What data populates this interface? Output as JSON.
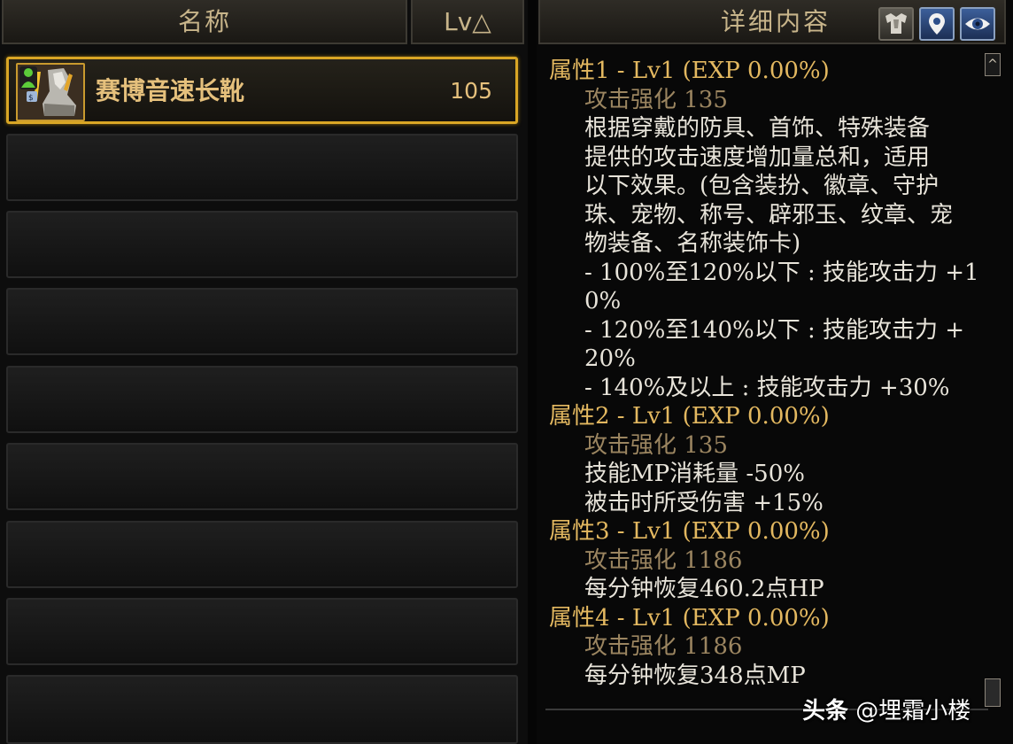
{
  "list": {
    "col_name": "名称",
    "col_lv": "Lv△",
    "items": [
      {
        "name": "赛博音速长靴",
        "level": "105",
        "icon": "boots-icon"
      }
    ]
  },
  "detail": {
    "title": "详细内容",
    "buttons": [
      {
        "icon": "armor-icon"
      },
      {
        "icon": "location-pin-icon"
      },
      {
        "icon": "eye-icon"
      }
    ],
    "scroll_up": "^",
    "lines": [
      {
        "text": "属性1 - Lv1 (EXP 0.00%)",
        "style": "gold"
      },
      {
        "text": "攻击强化 135",
        "style": "dim"
      },
      {
        "text": "根据穿戴的防具、首饰、特殊装备",
        "style": "white"
      },
      {
        "text": "提供的攻击速度增加量总和，适用",
        "style": "white"
      },
      {
        "text": "以下效果。(包含装扮、徽章、守护",
        "style": "white"
      },
      {
        "text": "珠、宠物、称号、辟邪玉、纹章、宠",
        "style": "white"
      },
      {
        "text": "物装备、名称装饰卡)",
        "style": "white"
      },
      {
        "text": "- 100%至120%以下 : 技能攻击力 +1",
        "style": "white"
      },
      {
        "text": "0%",
        "style": "white"
      },
      {
        "text": "- 120%至140%以下 : 技能攻击力 +",
        "style": "white"
      },
      {
        "text": "20%",
        "style": "white"
      },
      {
        "text": "- 140%及以上 : 技能攻击力 +30%",
        "style": "white"
      },
      {
        "text": "属性2 - Lv1 (EXP 0.00%)",
        "style": "gold"
      },
      {
        "text": "攻击强化 135",
        "style": "dim"
      },
      {
        "text": "技能MP消耗量 -50%",
        "style": "white"
      },
      {
        "text": "被击时所受伤害 +15%",
        "style": "white"
      },
      {
        "text": "属性3 - Lv1 (EXP 0.00%)",
        "style": "gold"
      },
      {
        "text": "攻击强化 1186",
        "style": "dim"
      },
      {
        "text": "每分钟恢复460.2点HP",
        "style": "white"
      },
      {
        "text": "属性4 - Lv1 (EXP 0.00%)",
        "style": "gold"
      },
      {
        "text": "攻击强化 1186",
        "style": "dim"
      },
      {
        "text": "每分钟恢复348点MP",
        "style": "white"
      }
    ]
  },
  "watermark": {
    "brand": "头条",
    "handle": "@埋霜小楼"
  },
  "colors": {
    "accent_gold": "#d9a625",
    "attr_title": "#e3b860",
    "attr_dim": "#9b8560",
    "attr_text": "#e8e4da"
  }
}
